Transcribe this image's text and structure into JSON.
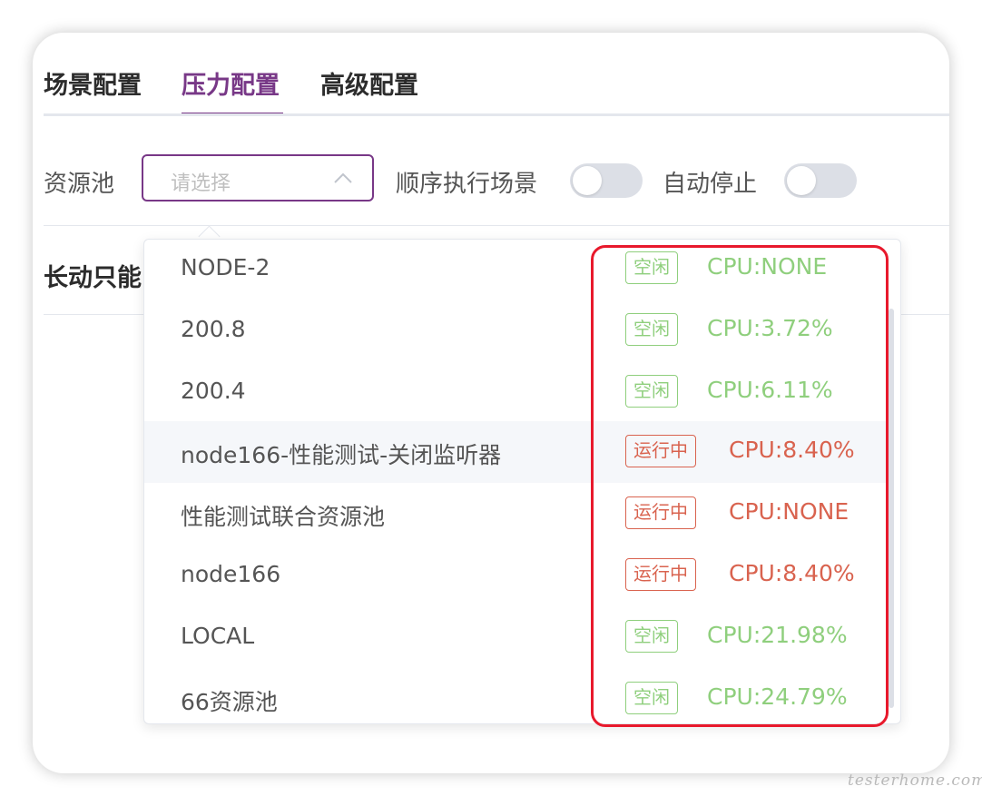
{
  "tabs": [
    {
      "label": "场景配置",
      "active": false
    },
    {
      "label": "压力配置",
      "active": true
    },
    {
      "label": "高级配置",
      "active": false
    }
  ],
  "form": {
    "resource_pool_label": "资源池",
    "resource_pool_placeholder": "请选择",
    "sequential_label": "顺序执行场景",
    "auto_stop_label": "自动停止",
    "sequential_on": false,
    "auto_stop_on": false
  },
  "section_title": "长动只能",
  "dropdown": {
    "options": [
      {
        "name": "NODE-2",
        "status": "空闲",
        "cpu": "CPU:NONE"
      },
      {
        "name": "200.8",
        "status": "空闲",
        "cpu": "CPU:3.72%"
      },
      {
        "name": "200.4",
        "status": "空闲",
        "cpu": "CPU:6.11%"
      },
      {
        "name": "node166-性能测试-关闭监听器",
        "status": "运行中",
        "cpu": "CPU:8.40%"
      },
      {
        "name": "性能测试联合资源池",
        "status": "运行中",
        "cpu": "CPU:NONE"
      },
      {
        "name": "node166",
        "status": "运行中",
        "cpu": "CPU:8.40%"
      },
      {
        "name": "LOCAL",
        "status": "空闲",
        "cpu": "CPU:21.98%"
      },
      {
        "name": "66资源池",
        "status": "空闲",
        "cpu": "CPU:24.79%"
      }
    ]
  },
  "colors": {
    "accent": "#783887",
    "idle": "#8fcf7d",
    "running": "#d9634f",
    "highlight": "#e8192c"
  },
  "watermark": "testerhome.com"
}
